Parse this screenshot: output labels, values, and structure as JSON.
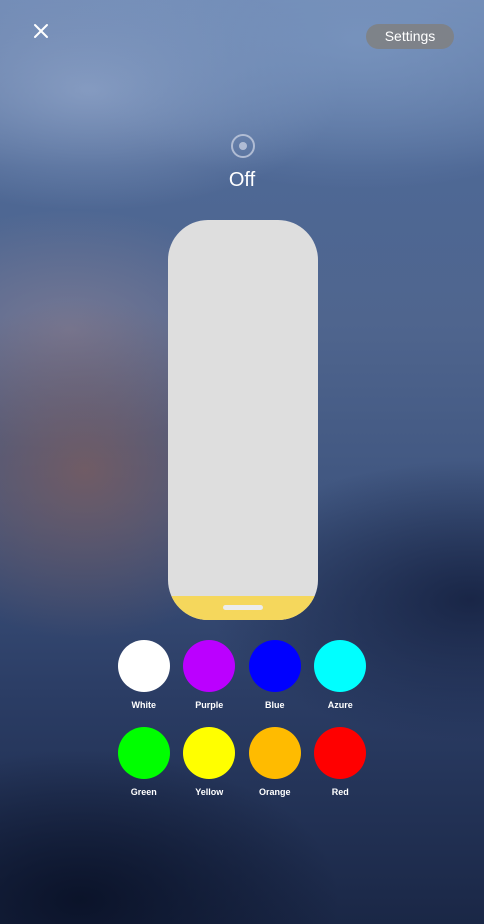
{
  "header": {
    "close_icon": "close-icon",
    "settings_label": "Settings"
  },
  "power": {
    "icon": "power-target-icon",
    "status": "Off"
  },
  "brightness": {
    "level": 0.06,
    "fill_color": "#F5D75C",
    "track_color": "#DEDEDE"
  },
  "colors": {
    "row1": [
      {
        "label": "White",
        "color": "#FFFFFF"
      },
      {
        "label": "Purple",
        "color": "#BB00FF"
      },
      {
        "label": "Blue",
        "color": "#0000FF"
      },
      {
        "label": "Azure",
        "color": "#00FFFF"
      }
    ],
    "row2": [
      {
        "label": "Green",
        "color": "#00FF00"
      },
      {
        "label": "Yellow",
        "color": "#FFFF00"
      },
      {
        "label": "Orange",
        "color": "#FFBB00"
      },
      {
        "label": "Red",
        "color": "#FF0000"
      }
    ]
  }
}
